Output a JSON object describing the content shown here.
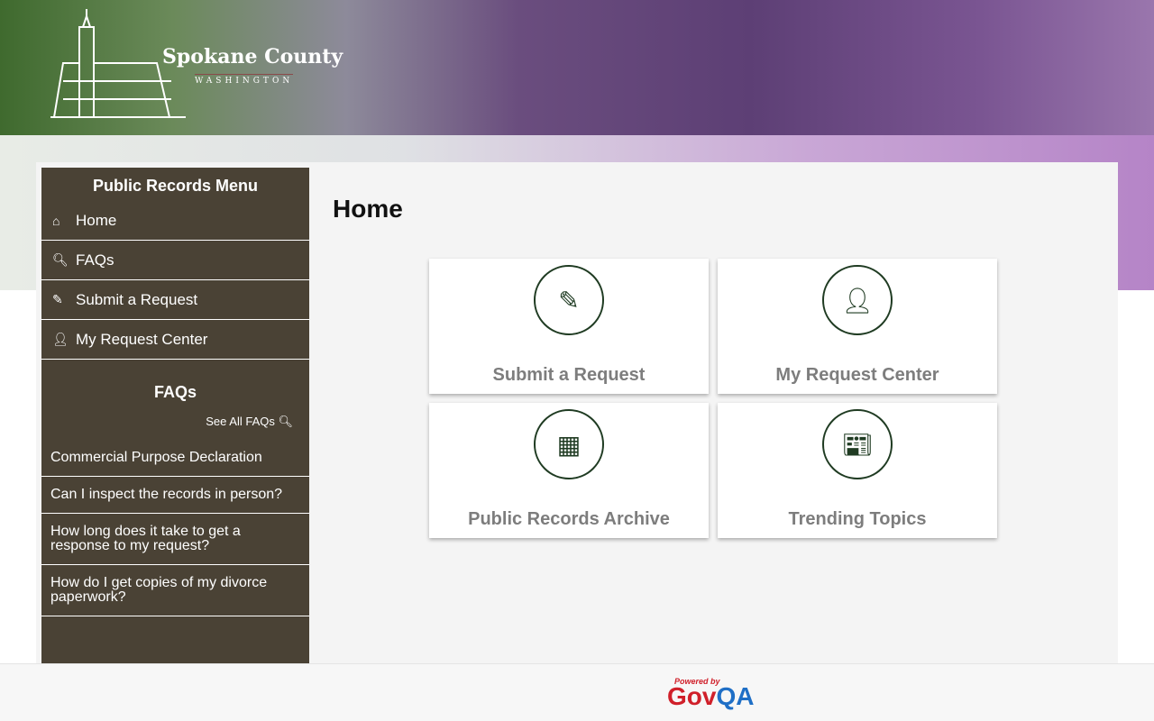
{
  "header": {
    "title": "Spokane County",
    "subtitle": "WASHINGTON"
  },
  "sidebar": {
    "title": "Public Records Menu",
    "items": [
      {
        "label": "Home",
        "icon": "home-icon"
      },
      {
        "label": "FAQs",
        "icon": "search-icon"
      },
      {
        "label": "Submit a Request",
        "icon": "edit-icon"
      },
      {
        "label": "My Request Center",
        "icon": "user-icon"
      }
    ],
    "faqs_title": "FAQs",
    "see_all": "See All FAQs",
    "faqs": [
      "Commercial Purpose Declaration",
      "Can I inspect the records in person?",
      "How long does it take to get a response to my request?",
      "How do I get copies of my divorce paperwork?"
    ]
  },
  "main": {
    "title": "Home",
    "tiles": [
      {
        "label": "Submit a Request",
        "icon": "edit-icon"
      },
      {
        "label": "My Request Center",
        "icon": "user-icon"
      },
      {
        "label": "Public Records Archive",
        "icon": "archive-icon"
      },
      {
        "label": "Trending Topics",
        "icon": "newspaper-icon"
      }
    ]
  },
  "footer": {
    "powered": "Powered by",
    "brand_a": "Gov",
    "brand_b": "QA"
  },
  "colors": {
    "sidebar": "#4a4235",
    "icon": "#1f3b22",
    "tile_text": "#7d7d7d"
  }
}
